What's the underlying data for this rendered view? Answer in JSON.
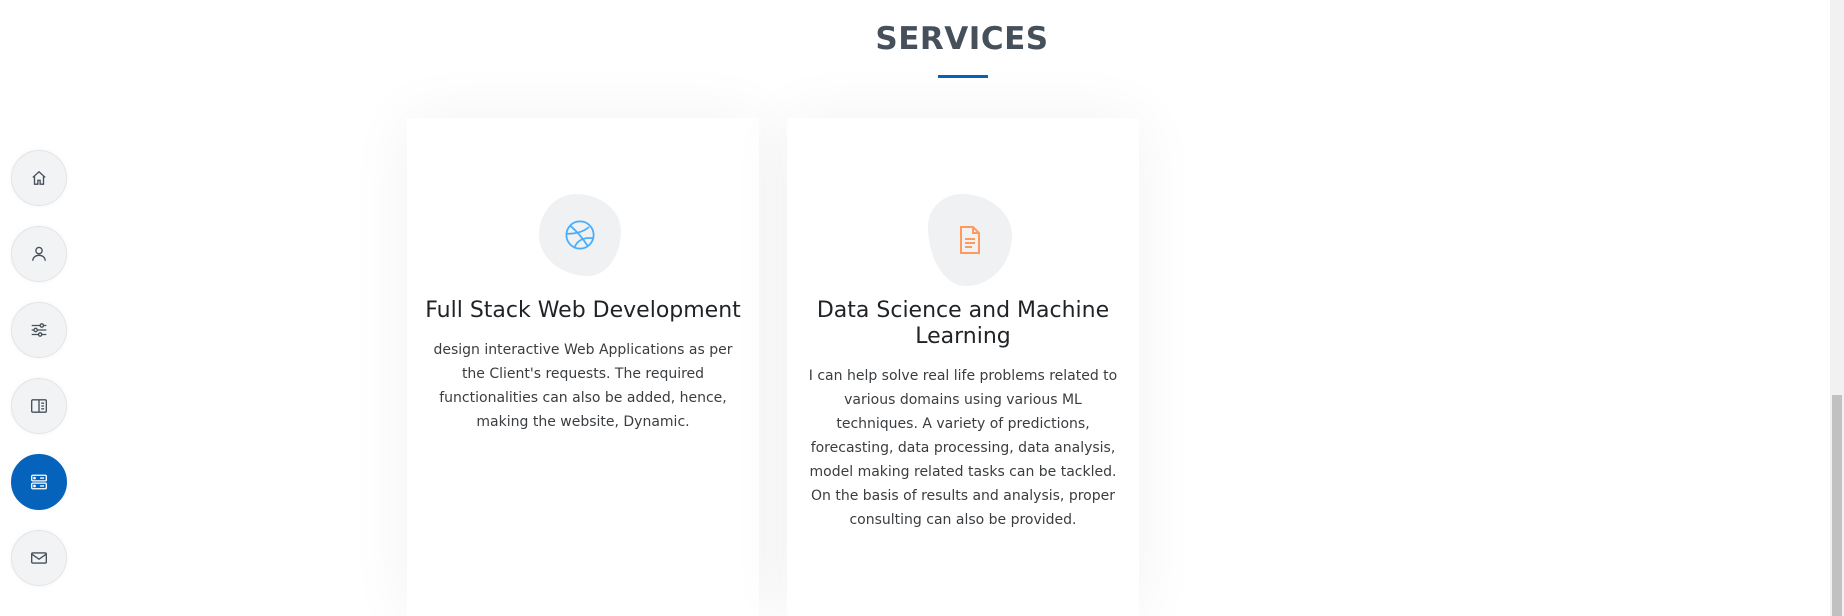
{
  "nav": {
    "items": [
      {
        "id": "home",
        "icon": "home-icon",
        "active": false
      },
      {
        "id": "about",
        "icon": "person-icon",
        "active": false
      },
      {
        "id": "skills",
        "icon": "sliders-icon",
        "active": false
      },
      {
        "id": "resume",
        "icon": "book-icon",
        "active": false
      },
      {
        "id": "services",
        "icon": "server-icon",
        "active": true
      },
      {
        "id": "contact",
        "icon": "envelope-icon",
        "active": false
      }
    ],
    "active_color": "#0563bb"
  },
  "section": {
    "title": "SERVICES",
    "underline_color": "#0563bb"
  },
  "services": [
    {
      "icon": "dribbble-icon",
      "icon_color": "#47aeff",
      "title": "Full Stack Web Development",
      "description": "design interactive Web Applications as per the Client's requests. The required functionalities can also be added, hence, making the website, Dynamic."
    },
    {
      "icon": "file-text-icon",
      "icon_color": "#ff9a5c",
      "title": "Data Science and Machine Learning",
      "description": "I can help solve real life problems related to various domains using various ML techniques. A variety of predictions, forecasting, data processing, data analysis, model making related tasks can be tackled. On the basis of results and analysis, proper consulting can also be provided."
    }
  ]
}
